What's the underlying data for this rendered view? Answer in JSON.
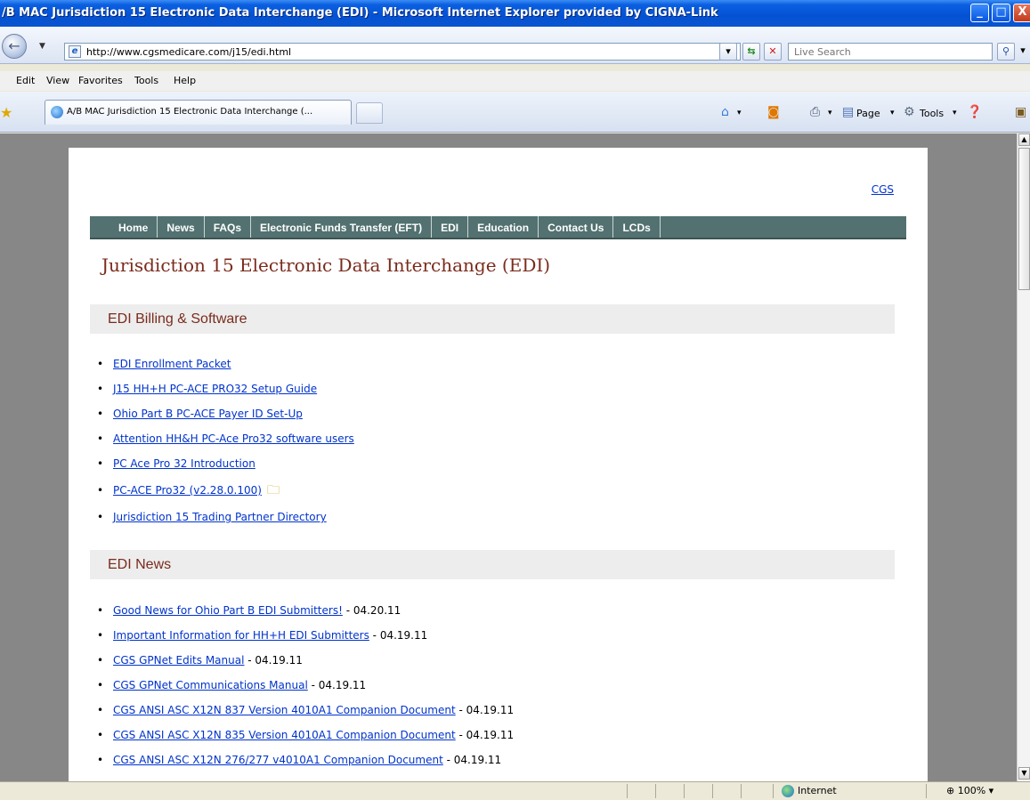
{
  "window": {
    "title": "/B MAC Jurisdiction 15 Electronic Data Interchange (EDI) - Microsoft Internet Explorer provided by CIGNA-Link",
    "min_label": "_",
    "max_label": "□",
    "close_label": "X"
  },
  "address": {
    "url": "http://www.cgsmedicare.com/j15/edi.html",
    "search_placeholder": "Live Search"
  },
  "menu": {
    "edit": "Edit",
    "view": "View",
    "favorites": "Favorites",
    "tools": "Tools",
    "help": "Help"
  },
  "tabs": {
    "active_label": "A/B MAC Jurisdiction 15 Electronic Data Interchange (..."
  },
  "commands": {
    "page": "Page",
    "tools": "Tools"
  },
  "page": {
    "cgs_link": "CGS",
    "nav": [
      "Home",
      "News",
      "FAQs",
      "Electronic Funds Transfer (EFT)",
      "EDI",
      "Education",
      "Contact Us",
      "LCDs"
    ],
    "title": "Jurisdiction 15 Electronic Data Interchange (EDI)",
    "section1_title": "EDI Billing & Software",
    "section1_links": [
      "EDI Enrollment Packet",
      "J15 HH+H PC-ACE PRO32 Setup Guide",
      "Ohio Part B PC-ACE Payer ID Set-Up",
      "Attention HH&H PC-Ace Pro32 software users",
      "PC Ace Pro 32 Introduction",
      "PC-ACE Pro32 (v2.28.0.100)",
      "Jurisdiction 15 Trading Partner Directory"
    ],
    "section2_title": "EDI News",
    "news": [
      {
        "link": "Good News for Ohio Part B EDI Submitters!",
        "date": " - 04.20.11"
      },
      {
        "link": "Important Information for HH+H EDI Submitters",
        "date": " - 04.19.11"
      },
      {
        "link": "CGS GPNet Edits Manual",
        "date": " - 04.19.11"
      },
      {
        "link": "CGS GPNet Communications Manual",
        "date": " - 04.19.11"
      },
      {
        "link": "CGS ANSI ASC X12N 837 Version 4010A1 Companion Document",
        "date": " - 04.19.11"
      },
      {
        "link": "CGS ANSI ASC X12N 835 Version 4010A1 Companion Document",
        "date": " - 04.19.11"
      },
      {
        "link": "CGS ANSI ASC X12N 276/277 v4010A1 Companion Document",
        "date": " - 04.19.11"
      }
    ]
  },
  "status": {
    "zone": "Internet",
    "zoom": "100%"
  }
}
